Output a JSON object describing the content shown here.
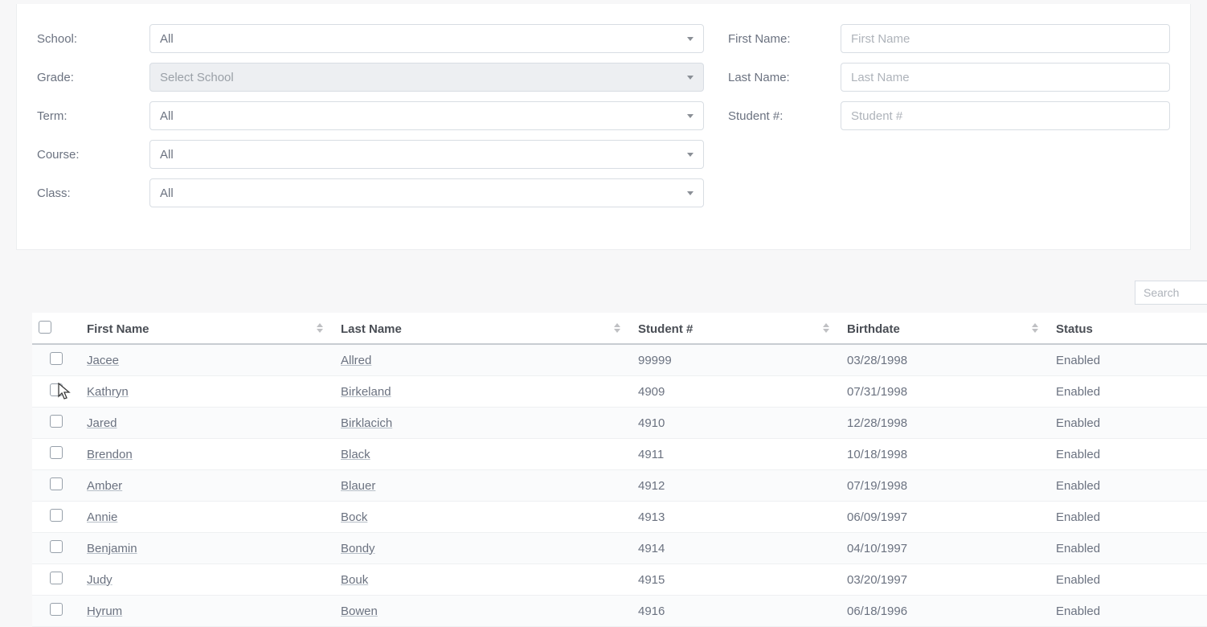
{
  "filters": {
    "school": {
      "label": "School:",
      "value": "All"
    },
    "grade": {
      "label": "Grade:",
      "value": "Select School"
    },
    "term": {
      "label": "Term:",
      "value": "All"
    },
    "course": {
      "label": "Course:",
      "value": "All"
    },
    "class": {
      "label": "Class:",
      "value": "All"
    },
    "firstName": {
      "label": "First Name:",
      "placeholder": "First Name"
    },
    "lastName": {
      "label": "Last Name:",
      "placeholder": "Last Name"
    },
    "studentNo": {
      "label": "Student #:",
      "placeholder": "Student #"
    }
  },
  "search": {
    "placeholder": "Search"
  },
  "table": {
    "headers": {
      "firstName": "First Name",
      "lastName": "Last Name",
      "studentNo": "Student #",
      "birthdate": "Birthdate",
      "status": "Status"
    },
    "rows": [
      {
        "firstName": "Jacee",
        "lastName": "Allred",
        "studentNo": "99999",
        "birthdate": "03/28/1998",
        "status": "Enabled"
      },
      {
        "firstName": "Kathryn",
        "lastName": "Birkeland",
        "studentNo": "4909",
        "birthdate": "07/31/1998",
        "status": "Enabled"
      },
      {
        "firstName": "Jared",
        "lastName": "Birklacich",
        "studentNo": "4910",
        "birthdate": "12/28/1998",
        "status": "Enabled"
      },
      {
        "firstName": "Brendon",
        "lastName": "Black",
        "studentNo": "4911",
        "birthdate": "10/18/1998",
        "status": "Enabled"
      },
      {
        "firstName": "Amber",
        "lastName": "Blauer",
        "studentNo": "4912",
        "birthdate": "07/19/1998",
        "status": "Enabled"
      },
      {
        "firstName": "Annie",
        "lastName": "Bock",
        "studentNo": "4913",
        "birthdate": "06/09/1997",
        "status": "Enabled"
      },
      {
        "firstName": "Benjamin",
        "lastName": "Bondy",
        "studentNo": "4914",
        "birthdate": "04/10/1997",
        "status": "Enabled"
      },
      {
        "firstName": "Judy",
        "lastName": "Bouk",
        "studentNo": "4915",
        "birthdate": "03/20/1997",
        "status": "Enabled"
      },
      {
        "firstName": "Hyrum",
        "lastName": "Bowen",
        "studentNo": "4916",
        "birthdate": "06/18/1996",
        "status": "Enabled"
      }
    ]
  }
}
